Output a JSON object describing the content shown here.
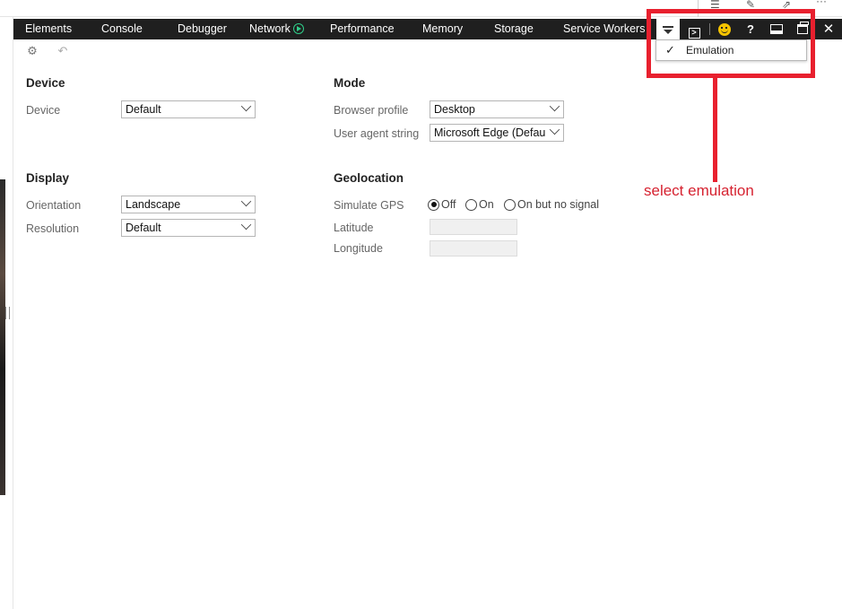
{
  "tabs": [
    {
      "label": "Elements"
    },
    {
      "label": "Console"
    },
    {
      "label": "Debugger"
    },
    {
      "label": "Network"
    },
    {
      "label": "Performance"
    },
    {
      "label": "Memory"
    },
    {
      "label": "Storage"
    },
    {
      "label": "Service Workers"
    }
  ],
  "toolbar_icons": {
    "more_tools": "overflow-icon",
    "console": "console-icon",
    "feedback": "smiley-icon",
    "help": "?",
    "dock": "dock-bottom-icon",
    "undock": "undock-icon",
    "close": "✕"
  },
  "dropdown": {
    "check": "✓",
    "item": "Emulation"
  },
  "device": {
    "title": "Device",
    "device_label": "Device",
    "device_value": "Default"
  },
  "mode": {
    "title": "Mode",
    "profile_label": "Browser profile",
    "profile_value": "Desktop",
    "ua_label": "User agent string",
    "ua_value": "Microsoft Edge (Default"
  },
  "display": {
    "title": "Display",
    "orientation_label": "Orientation",
    "orientation_value": "Landscape",
    "resolution_label": "Resolution",
    "resolution_value": "Default"
  },
  "geolocation": {
    "title": "Geolocation",
    "gps_label": "Simulate GPS",
    "gps_options": [
      "Off",
      "On",
      "On but no signal"
    ],
    "gps_selected": "Off",
    "latitude_label": "Latitude",
    "longitude_label": "Longitude"
  },
  "annotation": {
    "text": "select emulation",
    "color": "#e8202e"
  },
  "browser": {
    "ellipsis": "···"
  }
}
